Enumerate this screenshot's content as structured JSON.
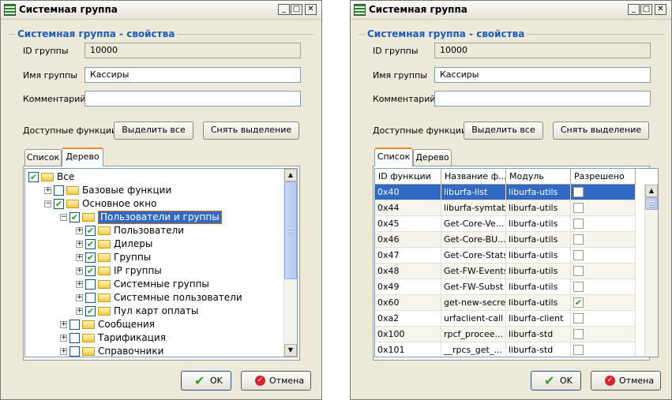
{
  "windows": [
    {
      "title": "Системная группа",
      "group_title": "Системная группа - свойства",
      "labels": {
        "id": "ID группы",
        "name": "Имя группы",
        "comment": "Комментарий",
        "functions": "Доступные функции"
      },
      "values": {
        "id": "10000",
        "name": "Кассиры",
        "comment": ""
      },
      "buttons": {
        "select_all": "Выделить все",
        "deselect": "Снять выделение",
        "ok": "OK",
        "cancel": "Отмена"
      },
      "tabs": [
        {
          "label": "Список",
          "active": false
        },
        {
          "label": "Дерево",
          "active": true
        }
      ],
      "tree": [
        {
          "label": "Все",
          "level": 0,
          "expander": "none",
          "checked": true,
          "open": true,
          "selected": false
        },
        {
          "label": "Базовые функции",
          "level": 1,
          "expander": "+",
          "checked": false,
          "open": false,
          "selected": false
        },
        {
          "label": "Основное окно",
          "level": 1,
          "expander": "-",
          "checked": true,
          "open": true,
          "selected": false
        },
        {
          "label": "Пользователи и группы",
          "level": 2,
          "expander": "-",
          "checked": true,
          "open": true,
          "selected": true
        },
        {
          "label": "Пользователи",
          "level": 3,
          "expander": "+",
          "checked": true,
          "open": false,
          "selected": false
        },
        {
          "label": "Дилеры",
          "level": 3,
          "expander": "+",
          "checked": true,
          "open": false,
          "selected": false
        },
        {
          "label": "Группы",
          "level": 3,
          "expander": "+",
          "checked": true,
          "open": false,
          "selected": false
        },
        {
          "label": "IP группы",
          "level": 3,
          "expander": "+",
          "checked": true,
          "open": false,
          "selected": false
        },
        {
          "label": "Системные группы",
          "level": 3,
          "expander": "+",
          "checked": false,
          "open": false,
          "selected": false
        },
        {
          "label": "Системные пользователи",
          "level": 3,
          "expander": "+",
          "checked": false,
          "open": false,
          "selected": false
        },
        {
          "label": "Пул карт оплаты",
          "level": 3,
          "expander": "+",
          "checked": true,
          "open": false,
          "selected": false
        },
        {
          "label": "Сообщения",
          "level": 2,
          "expander": "+",
          "checked": false,
          "open": false,
          "selected": false
        },
        {
          "label": "Тарификация",
          "level": 2,
          "expander": "+",
          "checked": false,
          "open": false,
          "selected": false
        },
        {
          "label": "Справочники",
          "level": 2,
          "expander": "+",
          "checked": false,
          "open": false,
          "selected": false
        }
      ]
    },
    {
      "title": "Системная группа",
      "group_title": "Системная группа - свойства",
      "labels": {
        "id": "ID группы",
        "name": "Имя группы",
        "comment": "Комментарий",
        "functions": "Доступные функции"
      },
      "values": {
        "id": "10000",
        "name": "Кассиры",
        "comment": ""
      },
      "buttons": {
        "select_all": "Выделить все",
        "deselect": "Снять выделение",
        "ok": "OK",
        "cancel": "Отмена"
      },
      "tabs": [
        {
          "label": "Список",
          "active": true
        },
        {
          "label": "Дерево",
          "active": false
        }
      ],
      "table": {
        "columns": [
          "ID функции",
          "Название ф...",
          "Модуль",
          "Разрешено"
        ],
        "rows": [
          {
            "id": "0x40",
            "name": "liburfa-list",
            "module": "liburfa-utils",
            "allowed": false,
            "selected": true
          },
          {
            "id": "0x44",
            "name": "liburfa-symtab",
            "module": "liburfa-utils",
            "allowed": false,
            "selected": false
          },
          {
            "id": "0x45",
            "name": "Get-Core-Ve...",
            "module": "liburfa-utils",
            "allowed": false,
            "selected": false
          },
          {
            "id": "0x46",
            "name": "Get-Core-BU...",
            "module": "liburfa-utils",
            "allowed": false,
            "selected": false
          },
          {
            "id": "0x47",
            "name": "Get-Core-Stats",
            "module": "liburfa-utils",
            "allowed": false,
            "selected": false
          },
          {
            "id": "0x48",
            "name": "Get-FW-Events",
            "module": "liburfa-utils",
            "allowed": false,
            "selected": false
          },
          {
            "id": "0x49",
            "name": "Get-FW-Subst",
            "module": "liburfa-utils",
            "allowed": false,
            "selected": false
          },
          {
            "id": "0x60",
            "name": "get-new-secret",
            "module": "liburfa-utils",
            "allowed": true,
            "selected": false
          },
          {
            "id": "0xa2",
            "name": "urfaclient-call",
            "module": "liburfa-client",
            "allowed": false,
            "selected": false
          },
          {
            "id": "0x100",
            "name": "rpcf_procee...",
            "module": "liburfa-std",
            "allowed": false,
            "selected": false
          },
          {
            "id": "0x101",
            "name": "__rpcs_get_...",
            "module": "liburfa-std",
            "allowed": false,
            "selected": false
          }
        ]
      }
    }
  ],
  "icons": {
    "app": "app-icon",
    "minimize": "minimize-icon",
    "maximize": "maximize-icon",
    "close": "close-icon",
    "ok": "checkmark-icon",
    "cancel": "cancel-icon",
    "folder": "folder-icon"
  },
  "colors": {
    "accent": "#1a5bc0",
    "selection": "#316ac5",
    "check": "#21a121"
  }
}
